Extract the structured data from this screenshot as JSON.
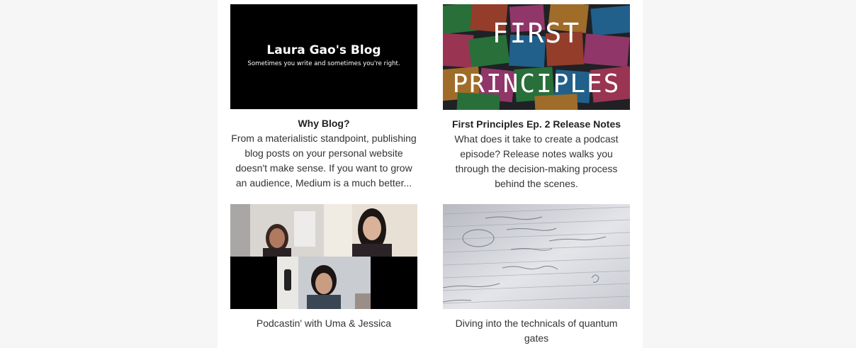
{
  "cards": [
    {
      "title": "Why Blog?",
      "description": "From a materialistic standpoint, publishing blog posts on your personal website doesn't make sense. If you want to grow an audience, Medium is a much better...",
      "thumbnail": {
        "icon": "blog-banner-image",
        "heading": "Laura Gao's Blog",
        "tagline": "Sometimes you write and sometimes you're right."
      }
    },
    {
      "title": "First Principles Ep. 2 Release Notes",
      "description": "What does it take to create a podcast episode? Release notes walks you through the decision-making process behind the scenes.",
      "thumbnail": {
        "icon": "first-principles-cover-image",
        "line1": "FIRST",
        "line2": "PRINCIPLES"
      }
    },
    {
      "caption": "Podcastin' with Uma & Jessica",
      "thumbnail": {
        "icon": "video-call-photo"
      }
    },
    {
      "caption": "Diving into the technicals of quantum gates",
      "thumbnail": {
        "icon": "handwritten-notes-photo"
      }
    }
  ],
  "colors": {
    "background": "#f6f6f6",
    "content": "#ffffff",
    "text": "#333333"
  }
}
